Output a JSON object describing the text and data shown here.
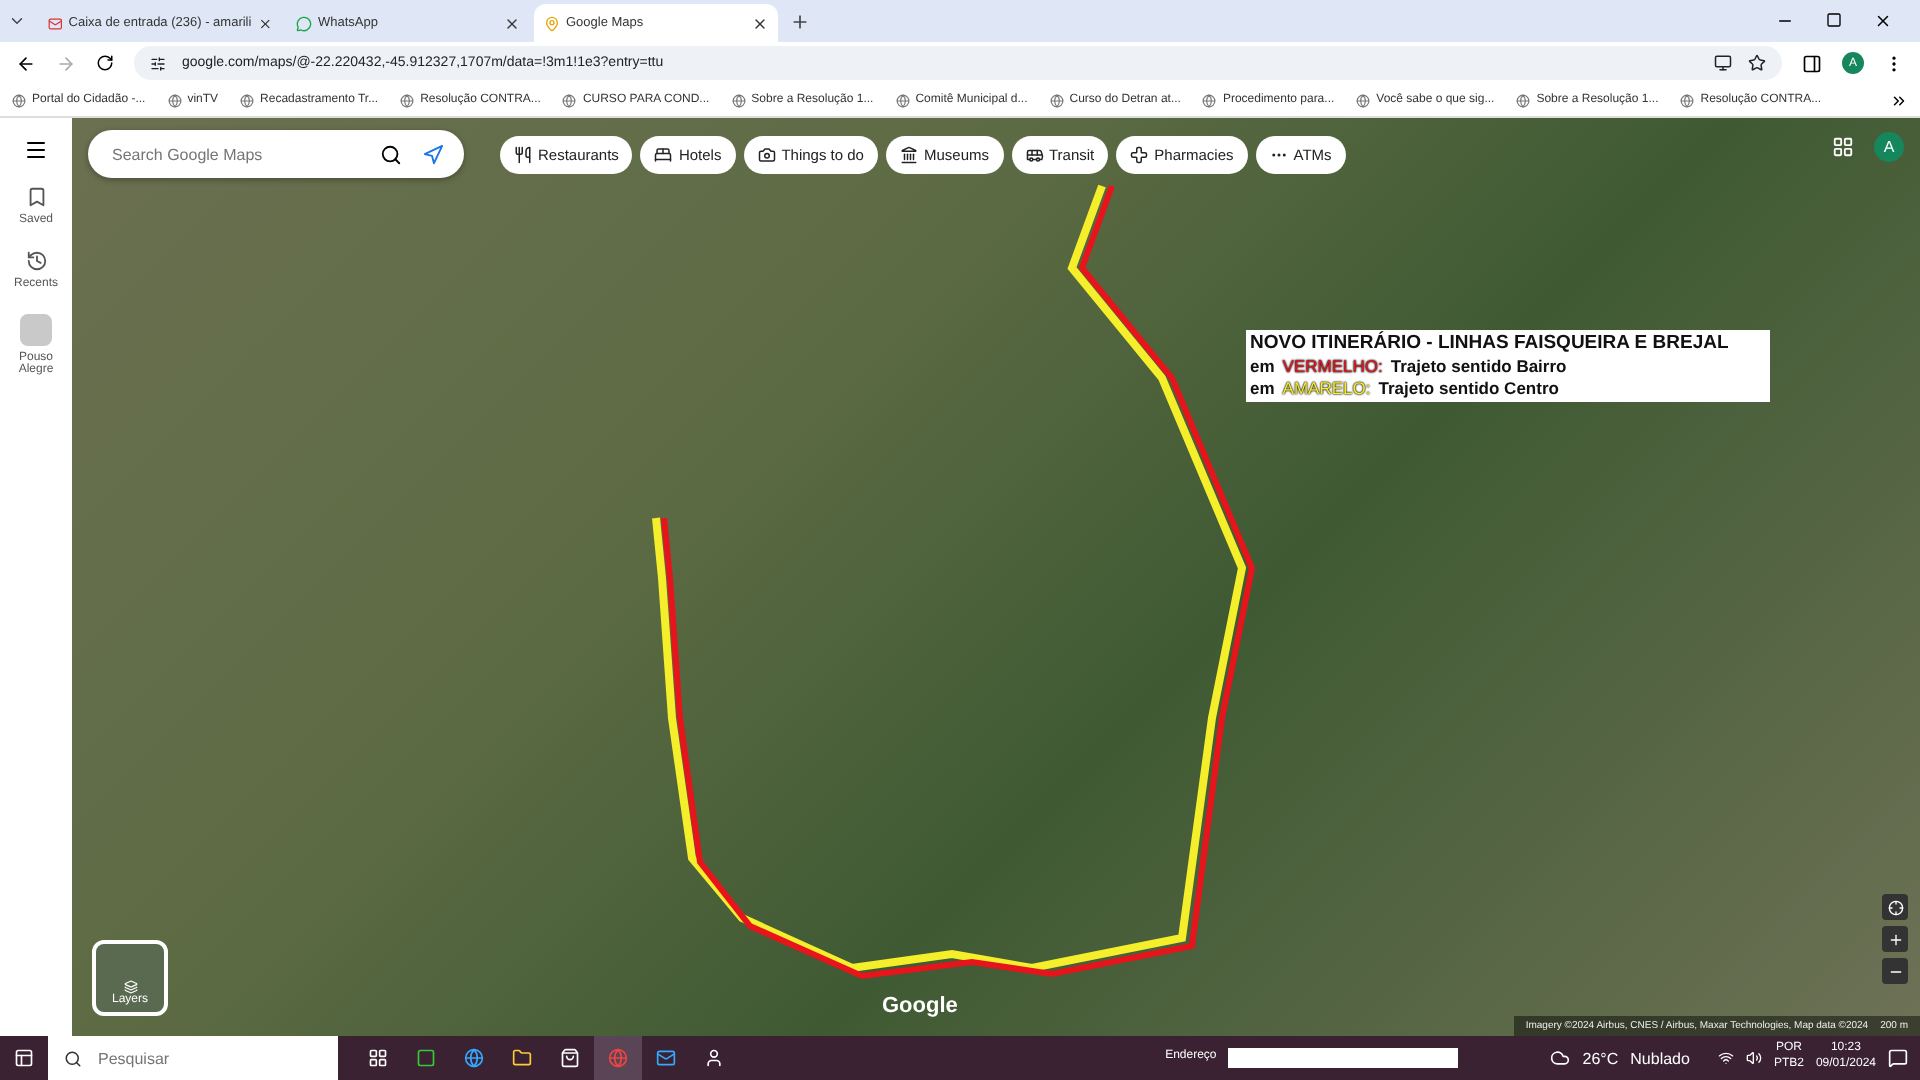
{
  "tabs": [
    {
      "title": "Caixa de entrada (236) - amarili",
      "kind": "mail",
      "selected": false
    },
    {
      "title": "WhatsApp",
      "kind": "chat",
      "selected": false
    },
    {
      "title": "Google Maps",
      "kind": "maps",
      "selected": true
    }
  ],
  "address_bar": {
    "url": "google.com/maps/@-22.220432,-45.912327,1707m/data=!3m1!1e3?entry=ttu",
    "profile": "A"
  },
  "maps_account": {
    "profile": "A"
  },
  "bookmarks": [
    {
      "title": "Portal do Cidadão -..."
    },
    {
      "title": "vinTV"
    },
    {
      "title": "Recadastramento Tr..."
    },
    {
      "title": "Resolução CONTRA..."
    },
    {
      "title": "CURSO PARA COND..."
    },
    {
      "title": "Sobre a Resolução 1..."
    },
    {
      "title": "Comitê Municipal d..."
    },
    {
      "title": "Curso do Detran at..."
    },
    {
      "title": "Procedimento para..."
    },
    {
      "title": "Você sabe o que sig..."
    },
    {
      "title": "Sobre a Resolução 1..."
    },
    {
      "title": "Resolução CONTRA..."
    }
  ],
  "sidebar": {
    "items": [
      {
        "label": "Saved",
        "kind": "saved"
      },
      {
        "label": "Recents",
        "kind": "recents"
      },
      {
        "label": "Pouso Alegre",
        "kind": "place"
      }
    ]
  },
  "search": {
    "placeholder": "Search Google Maps"
  },
  "chips": [
    {
      "label": "Restaurants",
      "kind": "food"
    },
    {
      "label": "Hotels",
      "kind": "bed"
    },
    {
      "label": "Things to do",
      "kind": "camera"
    },
    {
      "label": "Museums",
      "kind": "museum"
    },
    {
      "label": "Transit",
      "kind": "bus"
    },
    {
      "label": "Pharmacies",
      "kind": "pharmacy"
    },
    {
      "label": "ATMs",
      "kind": "more"
    }
  ],
  "notice": {
    "title": "NOVO ITINERÁRIO - LINHAS FAISQUEIRA E BREJAL",
    "lines": [
      {
        "prefix": "em",
        "color_word": "VERMELHO:",
        "color": "#e8141c",
        "text": "Trajeto sentido Bairro"
      },
      {
        "prefix": "em",
        "color_word": "AMARELO:",
        "color": "#f5ee2a",
        "text": "Trajeto sentido Centro"
      }
    ]
  },
  "map": {
    "layers_label": "Layers",
    "logo": "Google",
    "attribution": "Imagery ©2024 Airbus, CNES / Airbus, Maxar Technologies, Map data ©2024",
    "scale": "200 m"
  },
  "taskbar": {
    "search_placeholder": "Pesquisar",
    "address_label": "Endereço",
    "temperature": "26°C",
    "weather": "Nublado",
    "language": "POR",
    "layout": "PTB2",
    "time": "10:23",
    "date": "09/01/2024"
  }
}
